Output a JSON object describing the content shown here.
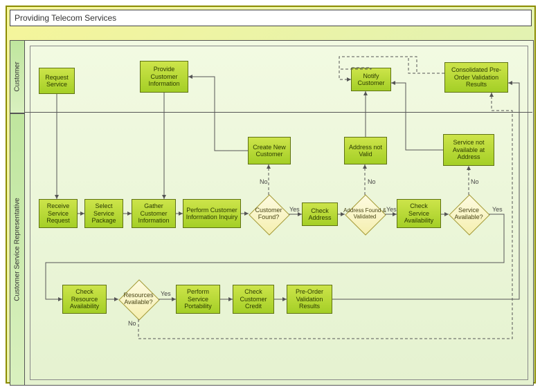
{
  "title": "Providing Telecom Services",
  "lanes": {
    "customer": "Customer",
    "csr": "Customer Service Representative"
  },
  "nodes": {
    "request_service": "Request Service",
    "provide_customer_info": "Provide Customer Information",
    "notify_customer": "Notify Customer",
    "consolidated_results": "Consolidated Pre-Order Validation Results",
    "receive_request": "Receive Service Request",
    "select_package": "Select Service Package",
    "gather_info": "Gather Customer Information",
    "perform_inquiry": "Perform Customer Information Inquiry",
    "create_new_customer": "Create New Customer",
    "check_address": "Check Address",
    "address_not_valid": "Address not Valid",
    "check_service_avail": "Check Service Availability",
    "service_not_avail": "Service not Available at Address",
    "check_resource_avail": "Check Resource Availability",
    "perform_portability": "Perform Service Portability",
    "check_credit": "Check Customer Credit",
    "preorder_results": "Pre-Order Validation Results"
  },
  "decisions": {
    "customer_found": "Customer Found?",
    "address_found": "Address Found & Validated",
    "service_available": "Service Available?",
    "resources_available": "Resources Available?"
  },
  "labels": {
    "yes": "Yes",
    "no": "No"
  },
  "chart_data": {
    "type": "swimlane-flowchart",
    "title": "Providing Telecom Services",
    "lanes": [
      "Customer",
      "Customer Service Representative"
    ],
    "nodes": [
      {
        "id": "request_service",
        "lane": "Customer",
        "type": "process",
        "label": "Request Service"
      },
      {
        "id": "provide_customer_info",
        "lane": "Customer",
        "type": "process",
        "label": "Provide Customer Information"
      },
      {
        "id": "notify_customer",
        "lane": "Customer",
        "type": "process",
        "label": "Notify Customer"
      },
      {
        "id": "consolidated_results",
        "lane": "Customer",
        "type": "process",
        "label": "Consolidated Pre-Order Validation Results"
      },
      {
        "id": "receive_request",
        "lane": "Customer Service Representative",
        "type": "process",
        "label": "Receive Service Request"
      },
      {
        "id": "select_package",
        "lane": "Customer Service Representative",
        "type": "process",
        "label": "Select Service Package"
      },
      {
        "id": "gather_info",
        "lane": "Customer Service Representative",
        "type": "process",
        "label": "Gather Customer Information"
      },
      {
        "id": "perform_inquiry",
        "lane": "Customer Service Representative",
        "type": "process",
        "label": "Perform Customer Information Inquiry"
      },
      {
        "id": "customer_found",
        "lane": "Customer Service Representative",
        "type": "decision",
        "label": "Customer Found?"
      },
      {
        "id": "create_new_customer",
        "lane": "Customer Service Representative",
        "type": "process",
        "label": "Create New Customer"
      },
      {
        "id": "check_address",
        "lane": "Customer Service Representative",
        "type": "process",
        "label": "Check Address"
      },
      {
        "id": "address_found",
        "lane": "Customer Service Representative",
        "type": "decision",
        "label": "Address Found & Validated"
      },
      {
        "id": "address_not_valid",
        "lane": "Customer Service Representative",
        "type": "process",
        "label": "Address not Valid"
      },
      {
        "id": "check_service_avail",
        "lane": "Customer Service Representative",
        "type": "process",
        "label": "Check Service Availability"
      },
      {
        "id": "service_available",
        "lane": "Customer Service Representative",
        "type": "decision",
        "label": "Service Available?"
      },
      {
        "id": "service_not_avail",
        "lane": "Customer Service Representative",
        "type": "process",
        "label": "Service not Available at Address"
      },
      {
        "id": "check_resource_avail",
        "lane": "Customer Service Representative",
        "type": "process",
        "label": "Check Resource Availability"
      },
      {
        "id": "resources_available",
        "lane": "Customer Service Representative",
        "type": "decision",
        "label": "Resources Available?"
      },
      {
        "id": "perform_portability",
        "lane": "Customer Service Representative",
        "type": "process",
        "label": "Perform Service Portability"
      },
      {
        "id": "check_credit",
        "lane": "Customer Service Representative",
        "type": "process",
        "label": "Check Customer Credit"
      },
      {
        "id": "preorder_results",
        "lane": "Customer Service Representative",
        "type": "process",
        "label": "Pre-Order Validation Results"
      }
    ],
    "edges": [
      {
        "from": "request_service",
        "to": "receive_request"
      },
      {
        "from": "receive_request",
        "to": "select_package"
      },
      {
        "from": "select_package",
        "to": "gather_info"
      },
      {
        "from": "provide_customer_info",
        "to": "gather_info"
      },
      {
        "from": "gather_info",
        "to": "perform_inquiry"
      },
      {
        "from": "perform_inquiry",
        "to": "customer_found"
      },
      {
        "from": "customer_found",
        "to": "check_address",
        "label": "Yes"
      },
      {
        "from": "customer_found",
        "to": "create_new_customer",
        "label": "No",
        "style": "dashed"
      },
      {
        "from": "create_new_customer",
        "to": "provide_customer_info"
      },
      {
        "from": "check_address",
        "to": "address_found"
      },
      {
        "from": "address_found",
        "to": "check_service_avail",
        "label": "Yes"
      },
      {
        "from": "address_found",
        "to": "address_not_valid",
        "label": "No",
        "style": "dashed"
      },
      {
        "from": "address_not_valid",
        "to": "notify_customer"
      },
      {
        "from": "check_service_avail",
        "to": "service_available"
      },
      {
        "from": "service_available",
        "to": "check_resource_avail",
        "label": "Yes"
      },
      {
        "from": "service_available",
        "to": "service_not_avail",
        "label": "No",
        "style": "dashed"
      },
      {
        "from": "service_not_avail",
        "to": "notify_customer"
      },
      {
        "from": "check_resource_avail",
        "to": "resources_available"
      },
      {
        "from": "resources_available",
        "to": "perform_portability",
        "label": "Yes"
      },
      {
        "from": "resources_available",
        "to": "consolidated_results",
        "label": "No",
        "style": "dashed"
      },
      {
        "from": "perform_portability",
        "to": "check_credit"
      },
      {
        "from": "check_credit",
        "to": "preorder_results"
      },
      {
        "from": "preorder_results",
        "to": "consolidated_results"
      },
      {
        "from": "notify_customer",
        "to": "consolidated_results",
        "direction": "from_consolidated_to_notify_area",
        "style": "dashed"
      }
    ]
  }
}
